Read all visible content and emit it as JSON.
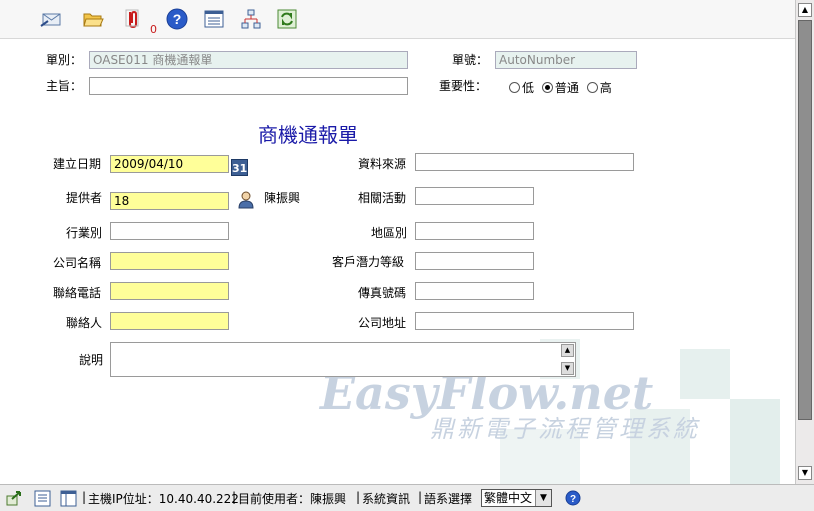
{
  "form": {
    "doc_type_label": "單別：",
    "doc_type_value": "OASE011 商機通報單",
    "doc_no_label": "單號：",
    "doc_no_value": "AutoNumber",
    "subject_label": "主旨：",
    "subject_value": "",
    "priority_label": "重要性：",
    "priority_options": [
      "低",
      "普通",
      "高"
    ],
    "priority_selected": "普通",
    "title": "商機通報單",
    "fields": {
      "created_date_label": "建立日期",
      "created_date_value": "2009/04/10",
      "calendar_label": "31",
      "data_source_label": "資料來源",
      "data_source_value": "",
      "provider_label": "提供者",
      "provider_value": "18",
      "provider_name": "陳振興",
      "related_activity_label": "相關活動",
      "related_activity_value": "",
      "industry_label": "行業別",
      "industry_value": "",
      "region_label": "地區別",
      "region_value": "",
      "company_name_label": "公司名稱",
      "company_name_value": "",
      "customer_potential_label": "客戶潛力等級",
      "customer_potential_value": "",
      "contact_phone_label": "聯絡電話",
      "contact_phone_value": "",
      "fax_label": "傳真號碼",
      "fax_value": "",
      "contact_person_label": "聯絡人",
      "contact_person_value": "",
      "company_address_label": "公司地址",
      "company_address_value": "",
      "description_label": "說明",
      "description_value": ""
    }
  },
  "toolbar": {
    "attachment_count": "0",
    "icons": [
      "send-icon",
      "open-folder-icon",
      "attachment-icon",
      "help-icon",
      "list-view-icon",
      "flowchart-icon",
      "refresh-icon"
    ]
  },
  "watermark": {
    "brand": "EasyFlow.net",
    "subtitle": "鼎新電子流程管理系統"
  },
  "status": {
    "host_ip": "主機IP位址：10.40.40.222",
    "current_user": "目前使用者：陳振興",
    "system_info": "系統資訊",
    "language_label": "語系選擇",
    "language_value": "繁體中文"
  },
  "colors": {
    "title": "#1a1aa8",
    "required_bg": "#ffff99",
    "readonly_bg": "#e7f2ef"
  }
}
